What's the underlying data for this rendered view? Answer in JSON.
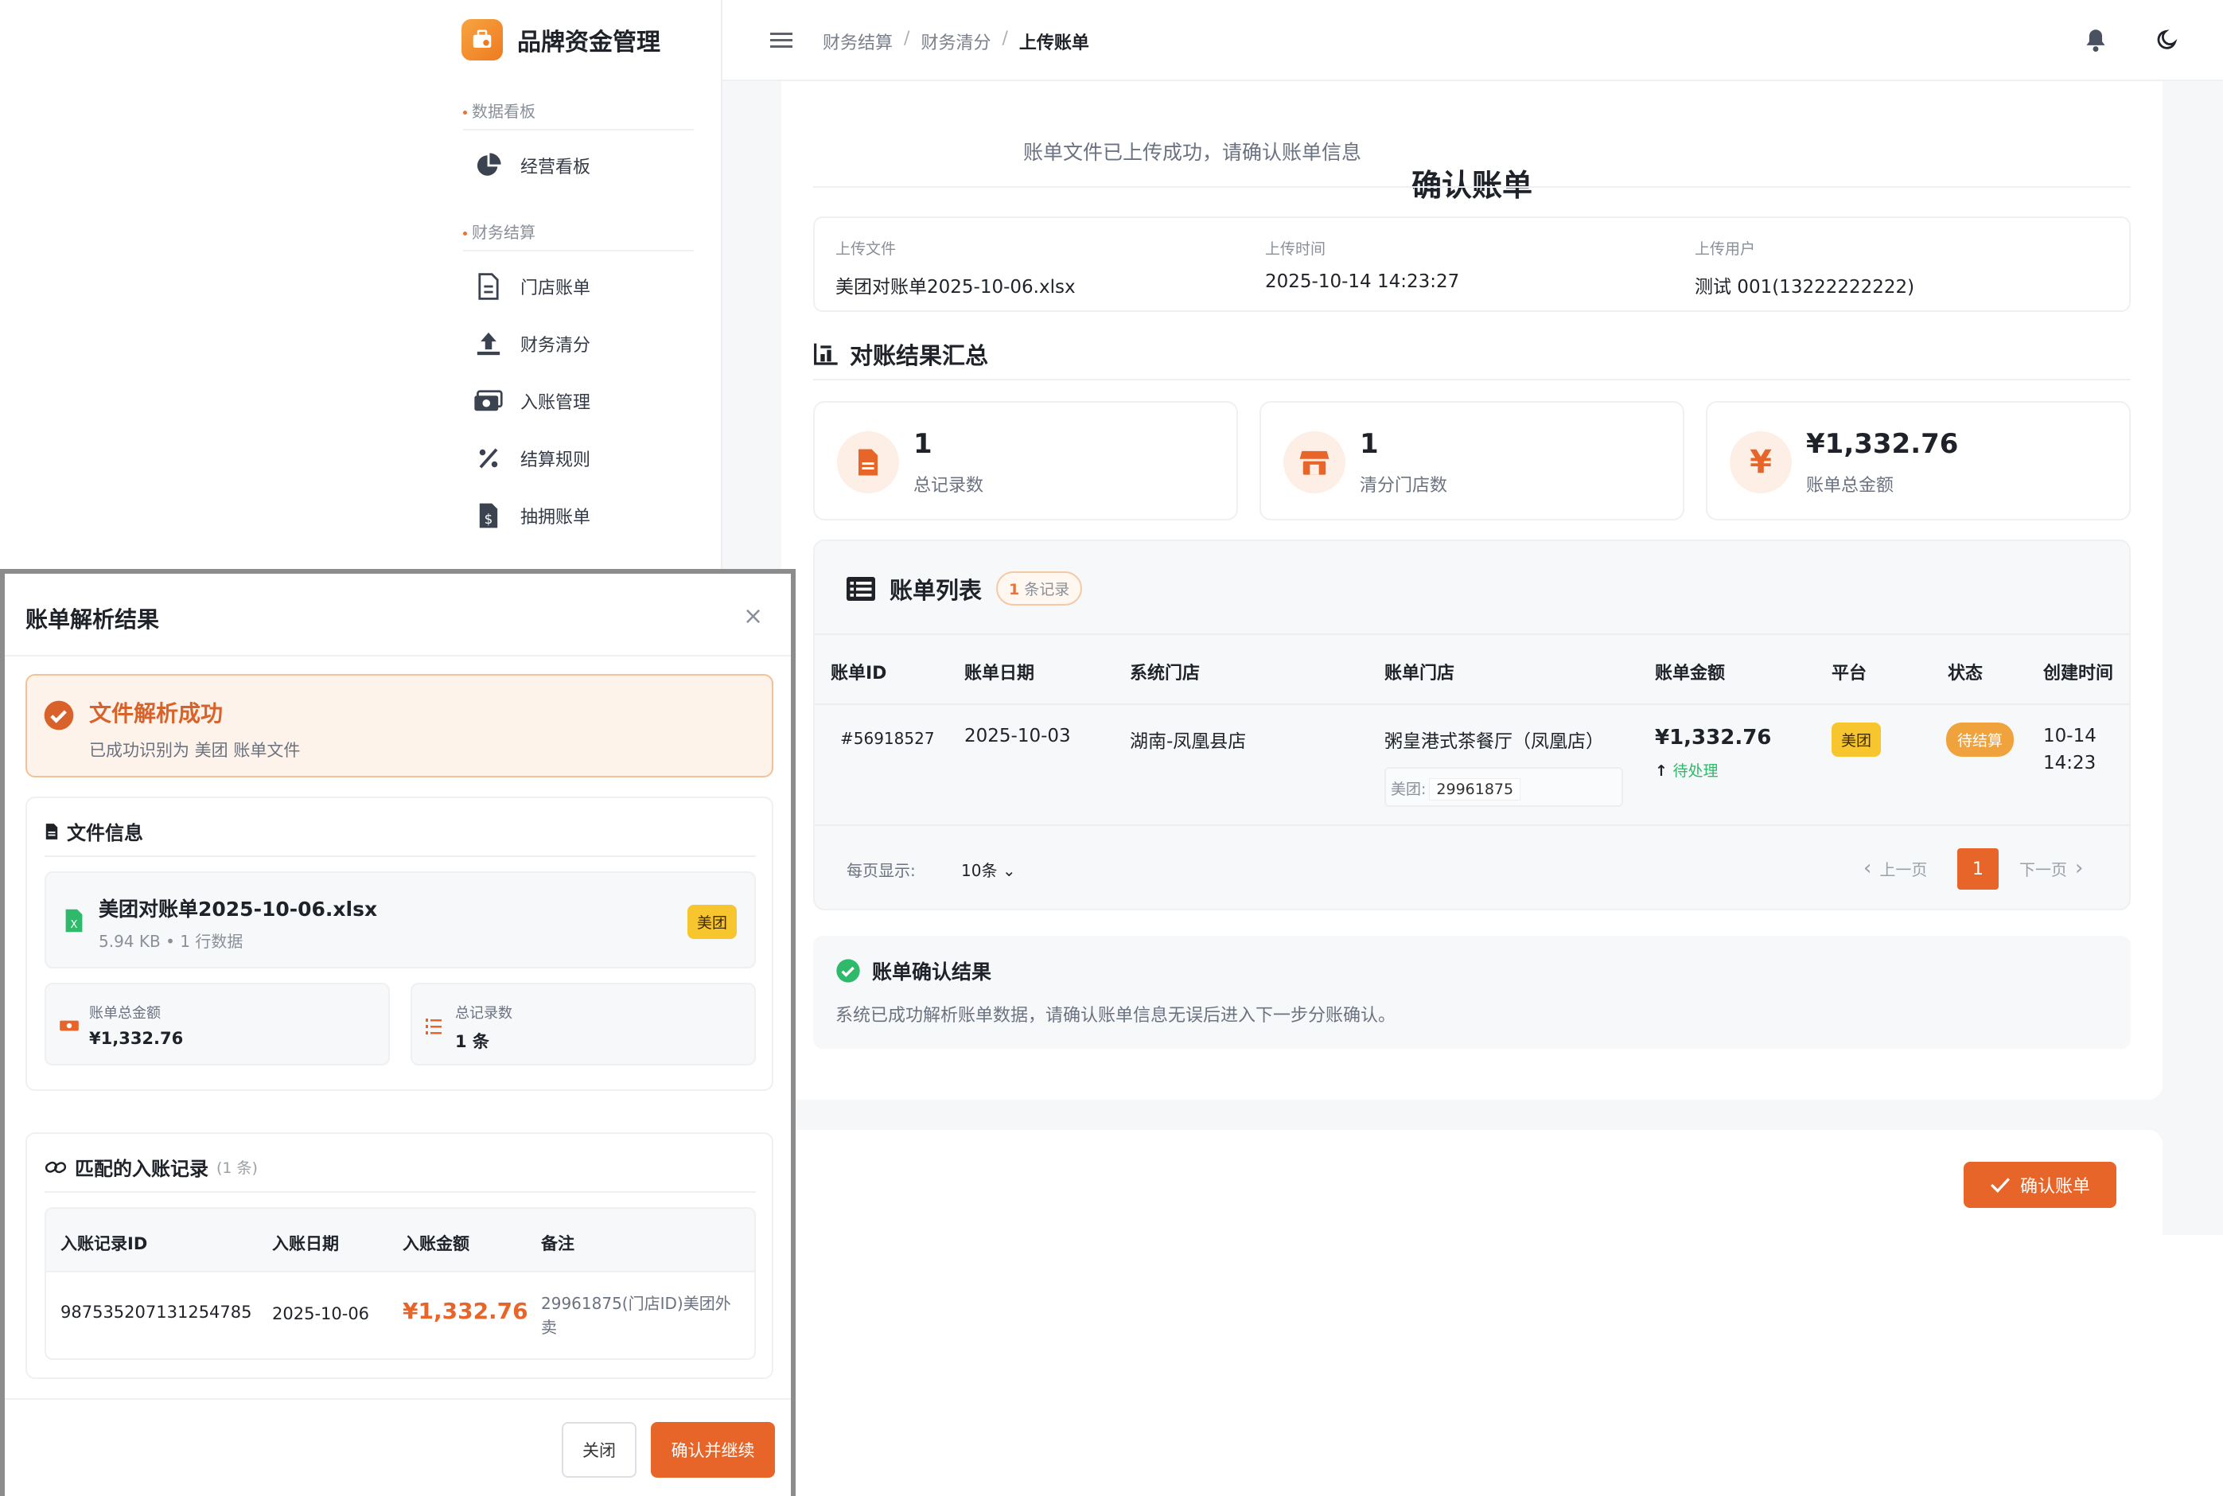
{
  "brand": {
    "title": "品牌资金管理"
  },
  "nav": {
    "group1": "数据看板",
    "group2": "财务结算",
    "items": [
      {
        "label": "经营看板",
        "icon": "pie-chart-icon"
      },
      {
        "label": "门店账单",
        "icon": "file-icon"
      },
      {
        "label": "财务清分",
        "icon": "upload-icon"
      },
      {
        "label": "入账管理",
        "icon": "money-icon"
      },
      {
        "label": "结算规则",
        "icon": "percent-icon"
      },
      {
        "label": "抽拥账单",
        "icon": "invoice-icon"
      }
    ]
  },
  "breadcrumb": [
    "财务结算",
    "财务清分",
    "上传账单"
  ],
  "page": {
    "title": "确认账单",
    "subtitle": "账单文件已上传成功，请确认账单信息"
  },
  "upload_info": [
    {
      "label": "上传文件",
      "value": "美团对账单2025-10-06.xlsx"
    },
    {
      "label": "上传时间",
      "value": "2025-10-14 14:23:27"
    },
    {
      "label": "上传用户",
      "value": "测试 001(13222222222)"
    }
  ],
  "summary": {
    "title": "对账结果汇总",
    "stats": [
      {
        "value": "1",
        "label": "总记录数",
        "icon": "document-icon"
      },
      {
        "value": "1",
        "label": "清分门店数",
        "icon": "store-icon"
      },
      {
        "value": "¥1,332.76",
        "label": "账单总金额",
        "icon": "yen-icon"
      }
    ]
  },
  "bill_list": {
    "title": "账单列表",
    "count_num": "1",
    "count_text": "条记录",
    "headers": [
      "账单ID",
      "账单日期",
      "系统门店",
      "账单门店",
      "账单金额",
      "平台",
      "状态",
      "创建时间"
    ],
    "rows": [
      {
        "id": "#56918527",
        "date": "2025-10-03",
        "sys_store": "湖南-凤凰县店",
        "bill_store": "粥皇港式茶餐厅（凤凰店）",
        "platform_label": "美团:",
        "platform_id": "29961875",
        "amount": "¥1,332.76",
        "amount_status": "待处理",
        "platform": "美团",
        "status": "待结算",
        "created_line1": "10-14",
        "created_line2": "14:23"
      }
    ],
    "pager": {
      "per_page_label": "每页显示:",
      "per_page_value": "10条",
      "prev": "上一页",
      "current": "1",
      "next": "下一页"
    }
  },
  "confirm_result": {
    "title": "账单确认结果",
    "desc": "系统已成功解析账单数据，请确认账单信息无误后进入下一步分账确认。"
  },
  "confirm_button": "确认账单",
  "modal": {
    "title": "账单解析结果",
    "close_glyph": "×",
    "success_title": "文件解析成功",
    "success_desc": "已成功识别为 美团 账单文件",
    "file_section": "文件信息",
    "file_name": "美团对账单2025-10-06.xlsx",
    "file_meta": "5.94 KB • 1 行数据",
    "file_platform": "美团",
    "mini_stats": [
      {
        "label": "账单总金额",
        "value": "¥1,332.76"
      },
      {
        "label": "总记录数",
        "value": "1 条"
      }
    ],
    "match_section": "匹配的入账记录",
    "match_count": "(1 条)",
    "match_headers": [
      "入账记录ID",
      "入账日期",
      "入账金额",
      "备注"
    ],
    "match_rows": [
      {
        "id": "987535207131254785",
        "date": "2025-10-06",
        "amount": "¥1,332.76",
        "note": "29961875(门店ID)美团外卖"
      }
    ],
    "close_button": "关闭",
    "continue_button": "确认并继续"
  },
  "colors": {
    "accent": "#e8652a",
    "success": "#2fb96b",
    "tag_yellow": "#f7c52d",
    "tag_orange": "#f0a23d"
  }
}
